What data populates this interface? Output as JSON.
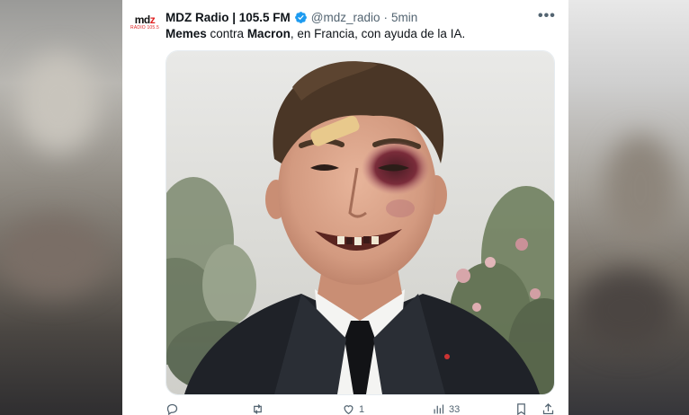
{
  "tweet": {
    "account_name": "MDZ Radio | 105.5 FM",
    "handle": "@mdz_radio",
    "separator": "·",
    "time": "5min",
    "more_label": "•••",
    "text_parts": [
      "Memes",
      " contra ",
      "Macron",
      ", en Francia, con ayuda de la IA."
    ],
    "logo_text_a": "md",
    "logo_text_b": "z",
    "logo_sub": "RADIO 105.5",
    "media_alt": "Edited photo of a smiling man in a dark suit with a black eye",
    "colors": {
      "verified": "#1d9bf0",
      "text": "#0f1419",
      "muted": "#536471"
    }
  },
  "actions": {
    "reply_count": "",
    "retweet_count": "",
    "like_count": "1",
    "views_count": "33"
  }
}
